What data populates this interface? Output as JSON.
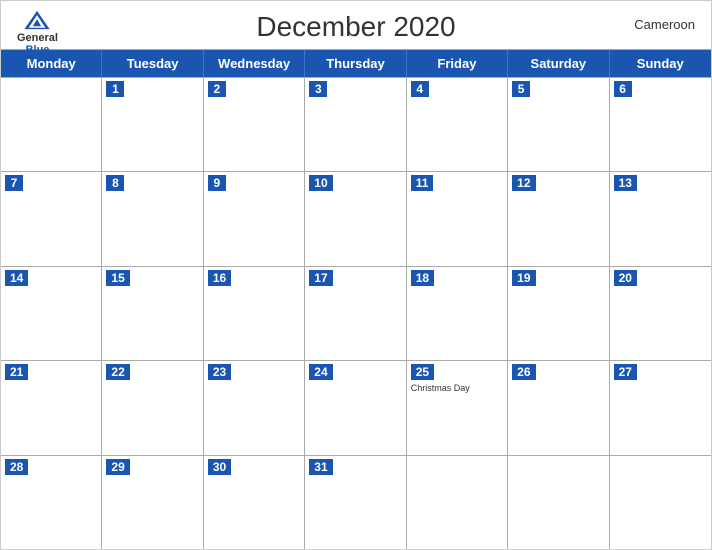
{
  "header": {
    "logo": {
      "general": "General",
      "blue": "Blue"
    },
    "title": "December 2020",
    "country": "Cameroon"
  },
  "dayHeaders": [
    "Monday",
    "Tuesday",
    "Wednesday",
    "Thursday",
    "Friday",
    "Saturday",
    "Sunday"
  ],
  "weeks": [
    [
      {
        "num": "",
        "empty": true
      },
      {
        "num": "1"
      },
      {
        "num": "2"
      },
      {
        "num": "3"
      },
      {
        "num": "4"
      },
      {
        "num": "5"
      },
      {
        "num": "6"
      }
    ],
    [
      {
        "num": "7"
      },
      {
        "num": "8"
      },
      {
        "num": "9"
      },
      {
        "num": "10"
      },
      {
        "num": "11"
      },
      {
        "num": "12"
      },
      {
        "num": "13"
      }
    ],
    [
      {
        "num": "14"
      },
      {
        "num": "15"
      },
      {
        "num": "16"
      },
      {
        "num": "17"
      },
      {
        "num": "18"
      },
      {
        "num": "19"
      },
      {
        "num": "20"
      }
    ],
    [
      {
        "num": "21"
      },
      {
        "num": "22"
      },
      {
        "num": "23"
      },
      {
        "num": "24"
      },
      {
        "num": "25",
        "holiday": "Christmas Day"
      },
      {
        "num": "26"
      },
      {
        "num": "27"
      }
    ],
    [
      {
        "num": "28"
      },
      {
        "num": "29"
      },
      {
        "num": "30"
      },
      {
        "num": "31"
      },
      {
        "num": "",
        "empty": true
      },
      {
        "num": "",
        "empty": true
      },
      {
        "num": "",
        "empty": true
      }
    ]
  ]
}
